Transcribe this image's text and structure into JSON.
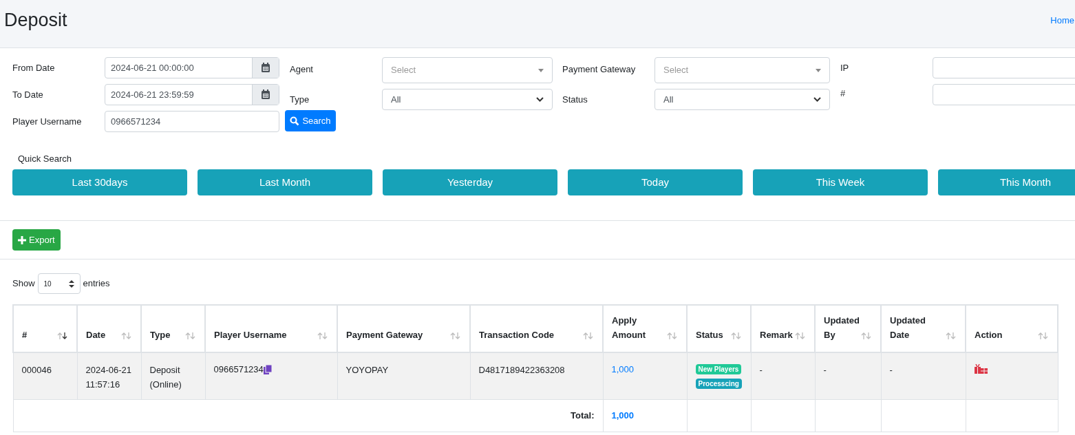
{
  "page": {
    "title": "Deposit",
    "breadcrumb": "Home"
  },
  "filters": {
    "from_date": {
      "label": "From Date",
      "value": "2024-06-21 00:00:00"
    },
    "to_date": {
      "label": "To Date",
      "value": "2024-06-21 23:59:59"
    },
    "player_username": {
      "label": "Player Username",
      "value": "0966571234"
    },
    "search_button": "Search",
    "agent": {
      "label": "Agent",
      "placeholder": "Select"
    },
    "type": {
      "label": "Type",
      "value": "All"
    },
    "payment_gateway": {
      "label": "Payment Gateway",
      "placeholder": "Select"
    },
    "status": {
      "label": "Status",
      "value": "All"
    },
    "ip": {
      "label": "IP"
    },
    "hash": {
      "label": "#"
    }
  },
  "quick_search": {
    "label": "Quick Search",
    "buttons": [
      "Last 30days",
      "Last Month",
      "Yesterday",
      "Today",
      "This Week",
      "This Month"
    ]
  },
  "export_button": "Export",
  "entries": {
    "show": "Show",
    "value": "10",
    "suffix": "entries"
  },
  "table": {
    "columns": [
      {
        "label": "#",
        "sorted_desc": true
      },
      {
        "label": "Date",
        "sorted_desc": false
      },
      {
        "label": "Type",
        "sorted_desc": false
      },
      {
        "label": "Player Username",
        "sorted_desc": false
      },
      {
        "label": "Payment Gateway",
        "sorted_desc": false
      },
      {
        "label": "Transaction Code",
        "sorted_desc": false
      },
      {
        "label": "Apply Amount",
        "sorted_desc": false
      },
      {
        "label": "Status",
        "sorted_desc": false
      },
      {
        "label": "Remark",
        "sorted_desc": false
      },
      {
        "label": "Updated By",
        "sorted_desc": false
      },
      {
        "label": "Updated Date",
        "sorted_desc": false
      },
      {
        "label": "Action",
        "sorted_desc": false
      }
    ],
    "rows": [
      {
        "id": "000046",
        "date": "2024-06-21 11:57:16",
        "type": "Deposit (Online)",
        "player_username": "0966571234",
        "payment_gateway": "YOYOPAY",
        "transaction_code": "D4817189422363208",
        "apply_amount": "1,000",
        "status_badges": [
          {
            "text": "New Players",
            "color": "#20c997"
          },
          {
            "text": "Processcing",
            "color": "#17a2b8"
          }
        ],
        "remark": "-",
        "updated_by": "-",
        "updated_date": "-"
      }
    ],
    "total": {
      "label": "Total:",
      "amount": "1,000"
    }
  }
}
